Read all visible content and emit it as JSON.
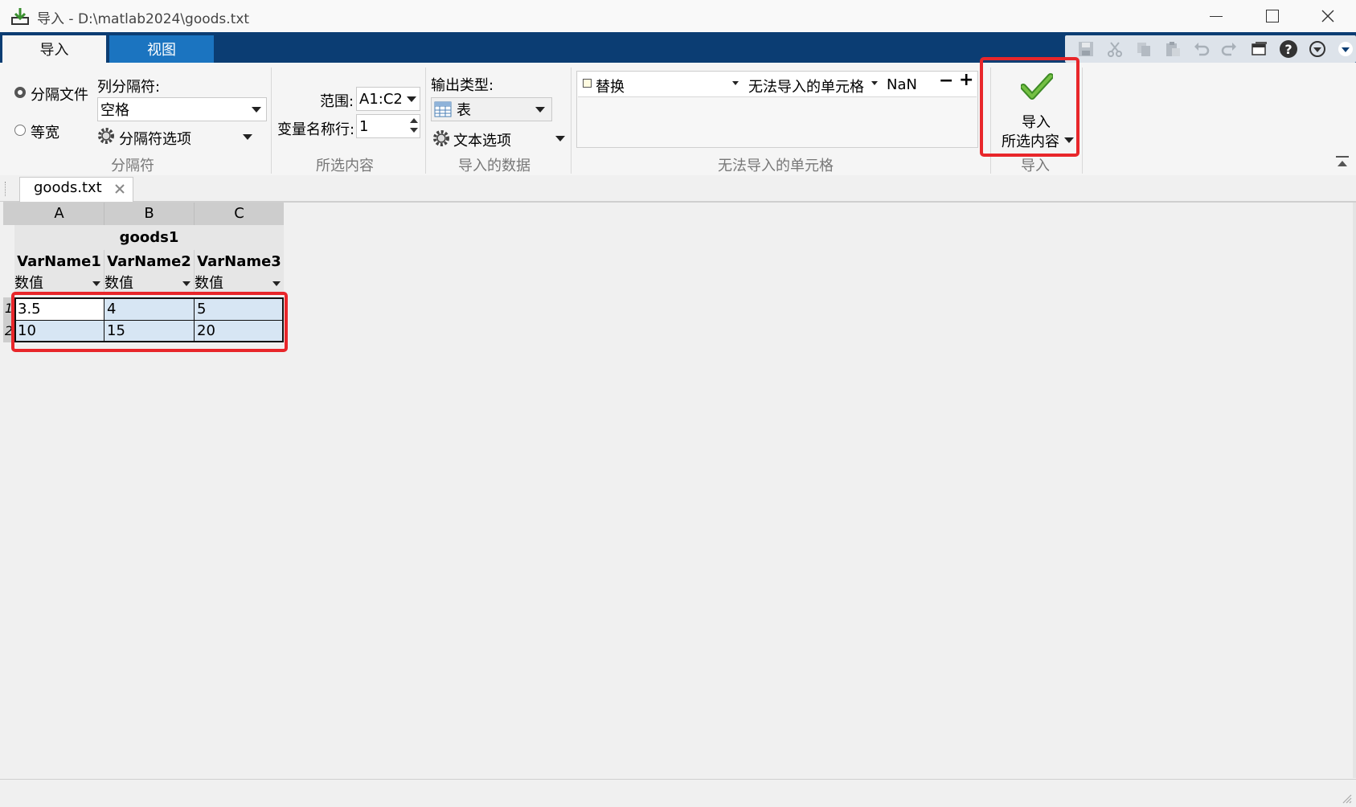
{
  "window": {
    "title": "导入 - D:\\matlab2024\\goods.txt",
    "controls": [
      "minimize-icon",
      "maximize-icon",
      "close-icon"
    ]
  },
  "ribbon_tabs": [
    {
      "label": "导入",
      "active": true
    },
    {
      "label": "视图",
      "active": false
    }
  ],
  "quick_access": [
    "save-icon",
    "cut-icon",
    "copy-icon",
    "paste-icon",
    "undo-icon",
    "redo-icon",
    "window-icon",
    "help-icon",
    "dropdown-icon"
  ],
  "delimiter_group": {
    "title": "分隔符",
    "radio_delimited": "分隔文件",
    "radio_fixed": "等宽",
    "col_delim_label": "列分隔符:",
    "col_delim_value": "空格",
    "delim_options": "分隔符选项"
  },
  "selection_group": {
    "title": "所选内容",
    "range_label": "范围:",
    "range_value": "A1:C2",
    "varname_row_label": "变量名称行:",
    "varname_row_value": "1"
  },
  "imported_data_group": {
    "title": "导入的数据",
    "output_type_label": "输出类型:",
    "output_type_value": "表",
    "text_options": "文本选项"
  },
  "unimportable_group": {
    "title": "无法导入的单元格",
    "rule_action": "替换",
    "rule_target": "无法导入的单元格",
    "rule_value": "NaN",
    "minus": "−",
    "plus": "+"
  },
  "import_group": {
    "title": "导入",
    "button_line1": "导入",
    "button_line2": "所选内容"
  },
  "document_tab": {
    "label": "goods.txt"
  },
  "sheet": {
    "columns": [
      "A",
      "B",
      "C"
    ],
    "table_name": "goods1",
    "var_names": [
      "VarName1",
      "VarName2",
      "VarName3"
    ],
    "var_types": [
      "数值",
      "数值",
      "数值"
    ],
    "rows": [
      {
        "num": "1",
        "cells": [
          "3.5",
          "4",
          "5"
        ]
      },
      {
        "num": "2",
        "cells": [
          "10",
          "15",
          "20"
        ]
      }
    ]
  },
  "colors": {
    "tab_strip": "#0b3d73",
    "active_blue_tab": "#1b74c0",
    "selection_fill": "#d7e6f4",
    "highlight_red": "#e8262a",
    "check_green": "#5aa832"
  }
}
